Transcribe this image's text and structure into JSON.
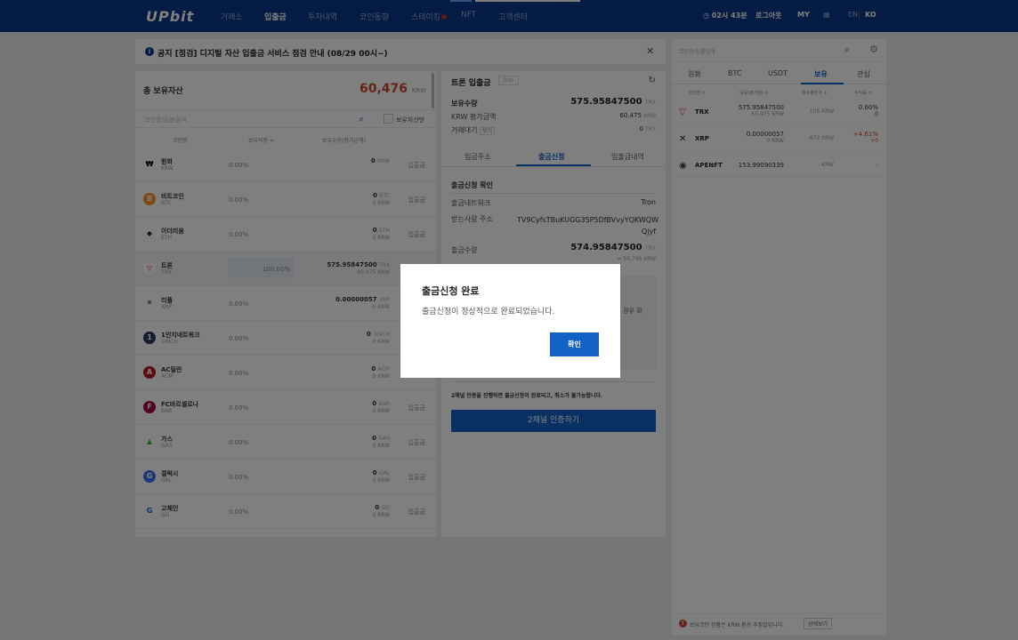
{
  "header": {
    "logo": "UPbit",
    "nav": [
      "거래소",
      "입출금",
      "투자내역",
      "코인동향",
      "스테이킹",
      "NFT",
      "고객센터"
    ],
    "nav_active": "입출금",
    "staking_mark": "✱",
    "timer": "02시 43분",
    "logout": "로그아웃",
    "my": "MY",
    "lang_en": "EN",
    "lang_ko": "KO"
  },
  "notice": {
    "icon": "i",
    "text": "공지 [점검] 디지털 자산 입출금 서비스 점검 안내 (08/29 00시~)"
  },
  "holdings": {
    "title": "총 보유자산",
    "total_value": "60,476",
    "total_unit": "KRW",
    "search_placeholder": "코인명/심볼검색",
    "only_holding_label": "보유자산만",
    "columns": [
      "코인명",
      "보유비중 ≑",
      "보유수량(평가금액)"
    ],
    "deposit_label": "입출금",
    "rows": [
      {
        "name": "원화",
        "symbol": "KRW",
        "pct": "0.00%",
        "amount": "0",
        "amount_unit": "KRW",
        "krw": "",
        "icon": "₩",
        "color": "#ffffff",
        "fg": "#000000",
        "btn": true
      },
      {
        "name": "비트코인",
        "symbol": "BTC",
        "pct": "0.00%",
        "amount": "0",
        "amount_unit": "BTC",
        "krw": "0 KRW",
        "icon": "B",
        "color": "#f7931a",
        "fg": "#ffffff",
        "btn": true
      },
      {
        "name": "이더리움",
        "symbol": "ETH",
        "pct": "0.00%",
        "amount": "0",
        "amount_unit": "ETH",
        "krw": "0 KRW",
        "icon": "◆",
        "color": "#ffffff",
        "fg": "#333333",
        "btn": true
      },
      {
        "name": "트론",
        "symbol": "TRX",
        "pct": "100.00%",
        "amount": "575.95847500",
        "amount_unit": "TRX",
        "krw": "60,475 KRW",
        "icon": "▽",
        "color": "#ffffff",
        "fg": "#e5312b",
        "btn": false,
        "sel": true
      },
      {
        "name": "리플",
        "symbol": "XRP",
        "pct": "0.00%",
        "amount": "0.00000057",
        "amount_unit": "XRP",
        "krw": "0 KRW",
        "icon": "✕",
        "color": "#ffffff",
        "fg": "#222222",
        "btn": false
      },
      {
        "name": "1인치네트워크",
        "symbol": "1INCH",
        "pct": "0.00%",
        "amount": "0",
        "amount_unit": "1INCH",
        "krw": "0 KRW",
        "icon": "1",
        "color": "#2b3a67",
        "fg": "#ffffff",
        "btn": false
      },
      {
        "name": "AC밀란",
        "symbol": "ACM",
        "pct": "0.00%",
        "amount": "0",
        "amount_unit": "ACM",
        "krw": "0 KRW",
        "icon": "A",
        "color": "#b11a26",
        "fg": "#ffffff",
        "btn": false
      },
      {
        "name": "FC바르셀로나",
        "symbol": "BAR",
        "pct": "0.00%",
        "amount": "0",
        "amount_unit": "BAR",
        "krw": "0 KRW",
        "icon": "F",
        "color": "#a50044",
        "fg": "#ffffff",
        "btn": true
      },
      {
        "name": "가스",
        "symbol": "GAS",
        "pct": "0.00%",
        "amount": "0",
        "amount_unit": "GAS",
        "krw": "0 KRW",
        "icon": "▲",
        "color": "#ffffff",
        "fg": "#4caf50",
        "btn": true
      },
      {
        "name": "갤럭시",
        "symbol": "GAL",
        "pct": "0.00%",
        "amount": "0",
        "amount_unit": "GAL",
        "krw": "0 KRW",
        "icon": "G",
        "color": "#3f6ff3",
        "fg": "#ffffff",
        "btn": true
      },
      {
        "name": "고체인",
        "symbol": "GO",
        "pct": "0.00%",
        "amount": "0",
        "amount_unit": "GO",
        "krw": "0 KRW",
        "icon": "G",
        "color": "#ffffff",
        "fg": "#1e64d0",
        "btn": true
      }
    ]
  },
  "transfer": {
    "title": "트론 입출금",
    "tag": "Tron",
    "held_label": "보유수량",
    "held_value": "575.95847500",
    "held_unit": "TRX",
    "krw_label": "KRW 평가금액",
    "krw_value": "60,475",
    "krw_unit": "KRW",
    "pending_label": "거래대기",
    "pending_tag": "보기",
    "pending_value": "0",
    "pending_unit": "TRX",
    "tabs": [
      "입금주소",
      "출금신청",
      "입출금내역"
    ],
    "confirm_title": "출금신청 확인",
    "network_label": "출금네트워크",
    "network_value": "Tron",
    "recipient_label": "받는사람 주소",
    "recipient_value": "TV9CyfsTBuKUGG35P5DfBVvyYQKWQW Qjyf",
    "amount_label": "출금수량",
    "amount_value": "574.95847500",
    "amount_unit": "TRX",
    "amount_krw": "≈ 59,796 KRW",
    "partial_text": "경우 확",
    "notice_text": "2채널 인증을 진행하면 출금신청이 완료되고, 취소가 불가능합니다.",
    "auth_button": "2채널 인증하기"
  },
  "market": {
    "search_placeholder": "코인명/심볼검색",
    "tabs": [
      "원화",
      "BTC",
      "USDT",
      "보유",
      "관심"
    ],
    "columns": [
      "코인명 ≑",
      "보유(평가금) ≑",
      "매수평균가 ≑",
      "수익률 ≑"
    ],
    "rows": [
      {
        "icon": "▽",
        "icon_color": "#e5312b",
        "name": "TRX",
        "held": "575.95847500",
        "krw": "60,475 KRW",
        "avg": "105 KRW",
        "pct": "0.00%",
        "pct2": "0",
        "color": "#333333"
      },
      {
        "icon": "✕",
        "icon_color": "#222222",
        "name": "XRP",
        "held": "0.00000057",
        "krw": "0 KRW",
        "avg": "672 KRW",
        "pct": "+4.61%",
        "pct2": "+0",
        "color": "#c84a31"
      },
      {
        "icon": "◉",
        "icon_color": "#444444",
        "name": "APENFT",
        "held": "153.99090339",
        "krw": "",
        "avg": "- KRW",
        "pct": "-",
        "pct2": "",
        "color": "#999999"
      }
    ],
    "footer_text": "보유코인 현황은 KRW 환산 추정값입니다.",
    "footer_button": "상세보기"
  },
  "modal": {
    "title": "출금신청 완료",
    "message": "출금신청이 정상적으로 완료되었습니다.",
    "ok": "확인"
  }
}
